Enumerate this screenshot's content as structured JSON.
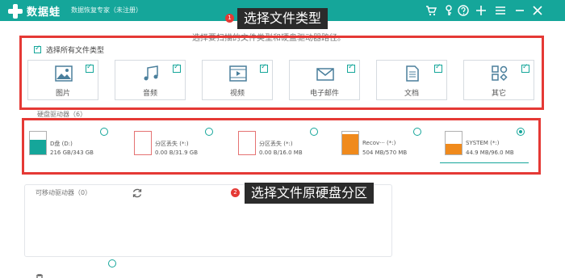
{
  "app": {
    "logo_text": "数据蛙",
    "subtitle": "数据恢复专家（未注册）",
    "titlebar_icons": [
      "cart-icon",
      "key-icon",
      "help-icon",
      "plus-icon",
      "menu-icon",
      "minimize-icon",
      "close-icon"
    ]
  },
  "instruction": "选择要扫描的文件类型和硬盘驱动器路径。",
  "annotations": {
    "callout1_number": "1",
    "callout1_text": "选择文件类型",
    "callout2_number": "2",
    "callout2_text": "选择文件原硬盘分区"
  },
  "file_types": {
    "select_all_label": "选择所有文件类型",
    "select_all_checked": true,
    "items": [
      {
        "label": "图片",
        "icon": "image-icon",
        "checked": true
      },
      {
        "label": "音频",
        "icon": "music-icon",
        "checked": true
      },
      {
        "label": "视频",
        "icon": "video-icon",
        "checked": true
      },
      {
        "label": "电子邮件",
        "icon": "email-icon",
        "checked": true
      },
      {
        "label": "文档",
        "icon": "document-icon",
        "checked": true
      },
      {
        "label": "其它",
        "icon": "other-icon",
        "checked": true
      }
    ]
  },
  "hard_drives": {
    "section_label": "硬盘驱动器（6）",
    "items": [
      {
        "name": "D盘 (D:)",
        "size": "216 GB/343 GB",
        "used_fraction": 0.63,
        "color": "#15a69a",
        "selected": false
      },
      {
        "name": "分区丢失 (*:)",
        "size": "0.00  B/31.9 GB",
        "used_fraction": 0,
        "color": "#e57373",
        "selected": false
      },
      {
        "name": "分区丢失 (*:)",
        "size": "0.00  B/16.0 MB",
        "used_fraction": 0,
        "color": "#e57373",
        "selected": false
      },
      {
        "name": "Recov··· (*:)",
        "size": "504 MB/570 MB",
        "used_fraction": 0.88,
        "color": "#f08a1c",
        "selected": false
      },
      {
        "name": "SYSTEM (*:)",
        "size": "44.9 MB/96.0 MB",
        "used_fraction": 0.47,
        "color": "#f08a1c",
        "selected": true
      }
    ]
  },
  "removable": {
    "section_label": "可移动驱动器（0）"
  },
  "colors": {
    "titlebar": "#15a69a",
    "annotation_red": "#e53935",
    "callout_bg": "#2b2b2b"
  }
}
